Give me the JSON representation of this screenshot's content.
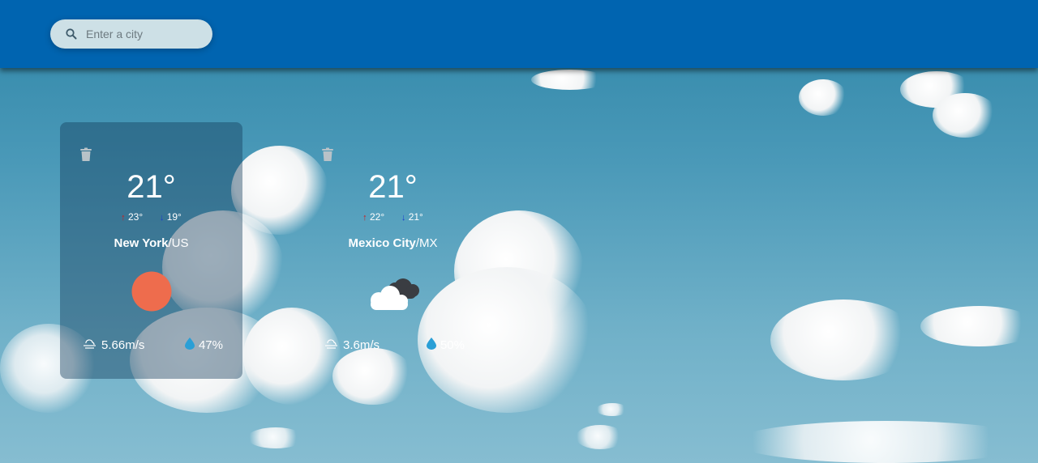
{
  "search": {
    "placeholder": "Enter a city"
  },
  "cards": [
    {
      "temp": "21°",
      "max": "23°",
      "min": "19°",
      "city": "New York",
      "country": "/US",
      "icon": "sun-icon",
      "wind": "5.66m/s",
      "humidity": "47%"
    },
    {
      "temp": "21°",
      "max": "22°",
      "min": "21°",
      "city": "Mexico City",
      "country": "/MX",
      "icon": "cloudy-icon",
      "wind": "3.6m/s",
      "humidity": "50%"
    }
  ],
  "colors": {
    "header": "#0064b0",
    "sun": "#ee6c4d",
    "drop": "#2a9fd6",
    "arrow_up": "#d01a1a",
    "arrow_down": "#1a3ad0"
  }
}
